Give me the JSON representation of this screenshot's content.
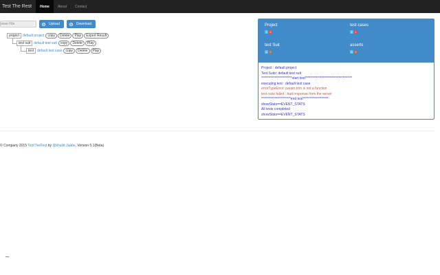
{
  "navbar": {
    "brand": "Test The Rest",
    "items": [
      {
        "label": "Home",
        "active": true
      },
      {
        "label": "About",
        "active": false
      },
      {
        "label": "Contact",
        "active": false
      }
    ]
  },
  "toolbar": {
    "file_placeholder": "oose File",
    "upload_label": "Upload",
    "download_label": "Download"
  },
  "tree": {
    "project": {
      "type": "project",
      "name": "default project",
      "actions": [
        "copy",
        "Delete",
        "Play",
        "Export Result"
      ]
    },
    "suite": {
      "type": "test suit",
      "name": "default test suit",
      "actions": [
        "copy",
        "Delete",
        "Play"
      ]
    },
    "case": {
      "type": "test",
      "name": "default test case",
      "actions": [
        "copy",
        "Delete",
        "Play"
      ]
    }
  },
  "stats": {
    "project": {
      "label": "Project",
      "pass": "1",
      "fail": "0"
    },
    "test_cases": {
      "label": "test cases",
      "pass": "1",
      "fail": "1"
    },
    "test_suit": {
      "label": "test Suit",
      "pass": "1",
      "fail": "0"
    },
    "asserts": {
      "label": "asserts",
      "pass": "0",
      "fail": "0"
    }
  },
  "log": [
    {
      "text": "Project : default project",
      "level": "info"
    },
    {
      "text": "Test Suits: default test suit",
      "level": "info"
    },
    {
      "text": "***********************start test***********************************",
      "level": "info"
    },
    {
      "text": "executing test : default test case",
      "level": "info"
    },
    {
      "text": "errorTypeError: param.trim is not a function",
      "level": "error"
    },
    {
      "text": "test case failed : bad response from the server",
      "level": "error"
    },
    {
      "text": "**********************end test*******************",
      "level": "info"
    },
    {
      "text": "showStats==EVENT_STATS",
      "level": "info"
    },
    {
      "text": "All tests completed",
      "level": "info"
    },
    {
      "text": "showStats==EVENT_STATS",
      "level": "info"
    }
  ],
  "footer": {
    "prefix": "© Company 2015 ",
    "link1": "TestTheRest",
    "middle": " by ",
    "link2": "@khalid.Jaafar",
    "suffix": ", Version 0.1(Beta)"
  },
  "colors": {
    "navbar": "#222222",
    "primary": "#428bca",
    "pass": "#5bc0de",
    "fail": "#d9534f"
  }
}
